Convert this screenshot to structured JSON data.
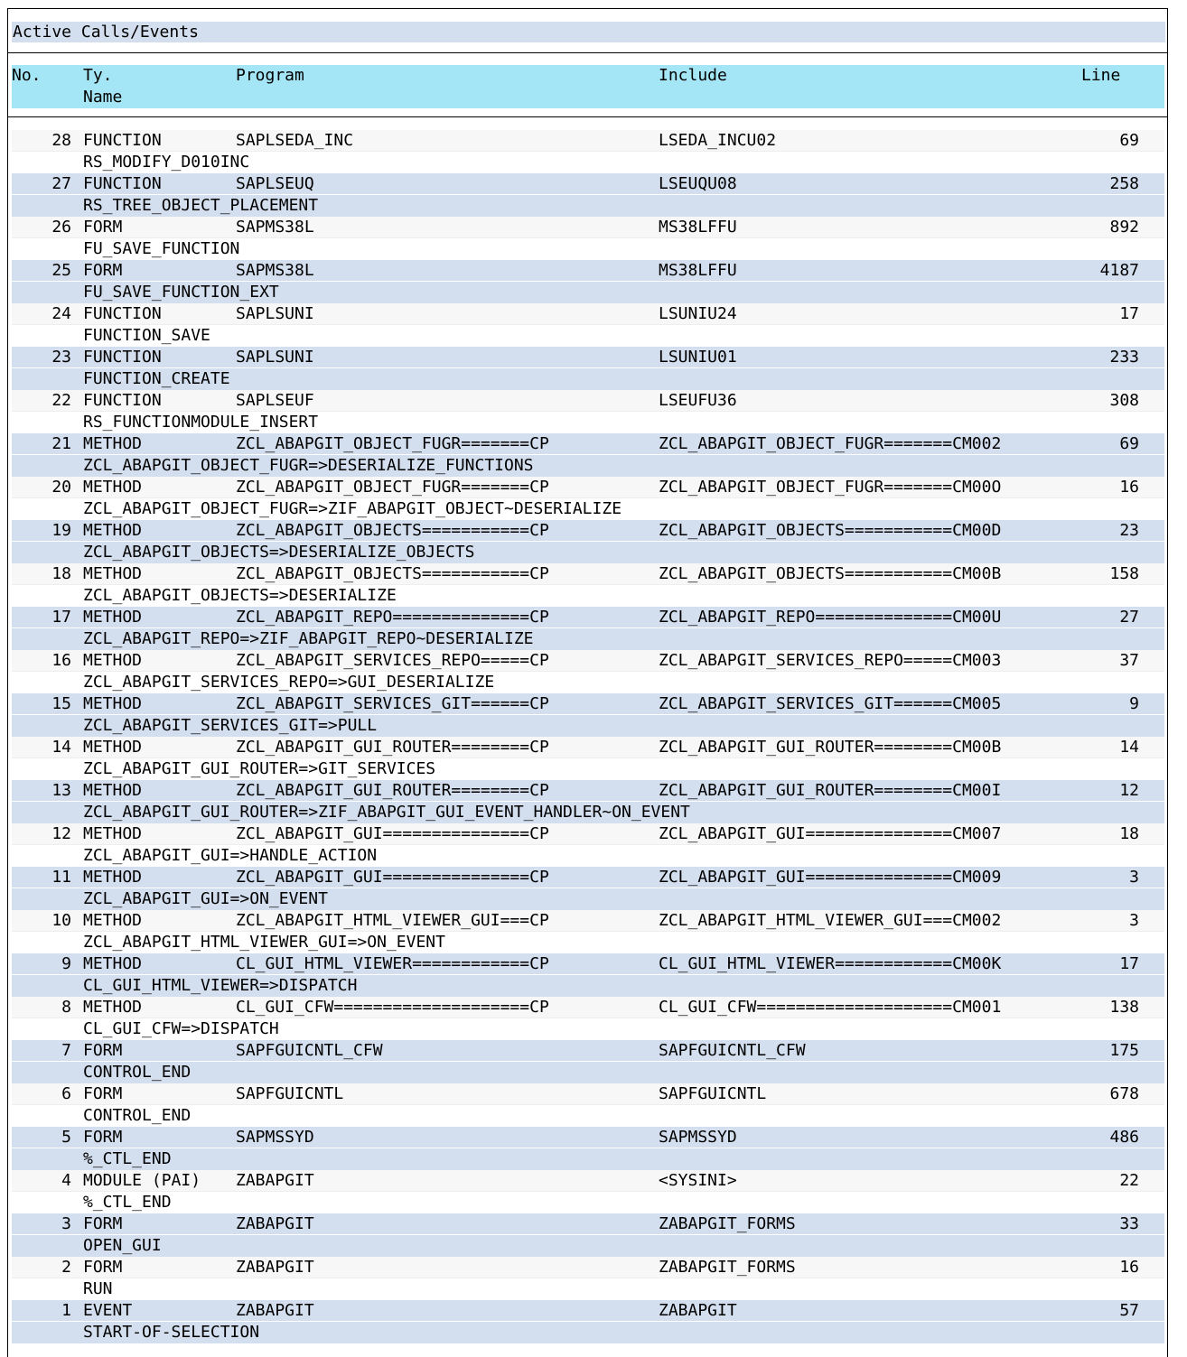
{
  "window": {
    "title": "Active Calls/Events"
  },
  "columns": {
    "no": "No.",
    "type": "Ty.",
    "program": "Program",
    "include": "Include",
    "line": "Line",
    "name": "Name"
  },
  "rows": [
    {
      "no": "28",
      "type": "FUNCTION",
      "program": "SAPLSEDA_INC",
      "include": "LSEDA_INCU02",
      "line": "69",
      "name": "RS_MODIFY_D010INC"
    },
    {
      "no": "27",
      "type": "FUNCTION",
      "program": "SAPLSEUQ",
      "include": "LSEUQU08",
      "line": "258",
      "name": "RS_TREE_OBJECT_PLACEMENT"
    },
    {
      "no": "26",
      "type": "FORM",
      "program": "SAPMS38L",
      "include": "MS38LFFU",
      "line": "892",
      "name": "FU_SAVE_FUNCTION"
    },
    {
      "no": "25",
      "type": "FORM",
      "program": "SAPMS38L",
      "include": "MS38LFFU",
      "line": "4187",
      "name": "FU_SAVE_FUNCTION_EXT"
    },
    {
      "no": "24",
      "type": "FUNCTION",
      "program": "SAPLSUNI",
      "include": "LSUNIU24",
      "line": "17",
      "name": "FUNCTION_SAVE"
    },
    {
      "no": "23",
      "type": "FUNCTION",
      "program": "SAPLSUNI",
      "include": "LSUNIU01",
      "line": "233",
      "name": "FUNCTION_CREATE"
    },
    {
      "no": "22",
      "type": "FUNCTION",
      "program": "SAPLSEUF",
      "include": "LSEUFU36",
      "line": "308",
      "name": "RS_FUNCTIONMODULE_INSERT"
    },
    {
      "no": "21",
      "type": "METHOD",
      "program": "ZCL_ABAPGIT_OBJECT_FUGR=======CP",
      "include": "ZCL_ABAPGIT_OBJECT_FUGR=======CM002",
      "line": "69",
      "name": "ZCL_ABAPGIT_OBJECT_FUGR=>DESERIALIZE_FUNCTIONS"
    },
    {
      "no": "20",
      "type": "METHOD",
      "program": "ZCL_ABAPGIT_OBJECT_FUGR=======CP",
      "include": "ZCL_ABAPGIT_OBJECT_FUGR=======CM00O",
      "line": "16",
      "name": "ZCL_ABAPGIT_OBJECT_FUGR=>ZIF_ABAPGIT_OBJECT~DESERIALIZE"
    },
    {
      "no": "19",
      "type": "METHOD",
      "program": "ZCL_ABAPGIT_OBJECTS===========CP",
      "include": "ZCL_ABAPGIT_OBJECTS===========CM00D",
      "line": "23",
      "name": "ZCL_ABAPGIT_OBJECTS=>DESERIALIZE_OBJECTS"
    },
    {
      "no": "18",
      "type": "METHOD",
      "program": "ZCL_ABAPGIT_OBJECTS===========CP",
      "include": "ZCL_ABAPGIT_OBJECTS===========CM00B",
      "line": "158",
      "name": "ZCL_ABAPGIT_OBJECTS=>DESERIALIZE"
    },
    {
      "no": "17",
      "type": "METHOD",
      "program": "ZCL_ABAPGIT_REPO==============CP",
      "include": "ZCL_ABAPGIT_REPO==============CM00U",
      "line": "27",
      "name": "ZCL_ABAPGIT_REPO=>ZIF_ABAPGIT_REPO~DESERIALIZE"
    },
    {
      "no": "16",
      "type": "METHOD",
      "program": "ZCL_ABAPGIT_SERVICES_REPO=====CP",
      "include": "ZCL_ABAPGIT_SERVICES_REPO=====CM003",
      "line": "37",
      "name": "ZCL_ABAPGIT_SERVICES_REPO=>GUI_DESERIALIZE"
    },
    {
      "no": "15",
      "type": "METHOD",
      "program": "ZCL_ABAPGIT_SERVICES_GIT======CP",
      "include": "ZCL_ABAPGIT_SERVICES_GIT======CM005",
      "line": "9",
      "name": "ZCL_ABAPGIT_SERVICES_GIT=>PULL"
    },
    {
      "no": "14",
      "type": "METHOD",
      "program": "ZCL_ABAPGIT_GUI_ROUTER========CP",
      "include": "ZCL_ABAPGIT_GUI_ROUTER========CM00B",
      "line": "14",
      "name": "ZCL_ABAPGIT_GUI_ROUTER=>GIT_SERVICES"
    },
    {
      "no": "13",
      "type": "METHOD",
      "program": "ZCL_ABAPGIT_GUI_ROUTER========CP",
      "include": "ZCL_ABAPGIT_GUI_ROUTER========CM00I",
      "line": "12",
      "name": "ZCL_ABAPGIT_GUI_ROUTER=>ZIF_ABAPGIT_GUI_EVENT_HANDLER~ON_EVENT"
    },
    {
      "no": "12",
      "type": "METHOD",
      "program": "ZCL_ABAPGIT_GUI===============CP",
      "include": "ZCL_ABAPGIT_GUI===============CM007",
      "line": "18",
      "name": "ZCL_ABAPGIT_GUI=>HANDLE_ACTION"
    },
    {
      "no": "11",
      "type": "METHOD",
      "program": "ZCL_ABAPGIT_GUI===============CP",
      "include": "ZCL_ABAPGIT_GUI===============CM009",
      "line": "3",
      "name": "ZCL_ABAPGIT_GUI=>ON_EVENT"
    },
    {
      "no": "10",
      "type": "METHOD",
      "program": "ZCL_ABAPGIT_HTML_VIEWER_GUI===CP",
      "include": "ZCL_ABAPGIT_HTML_VIEWER_GUI===CM002",
      "line": "3",
      "name": "ZCL_ABAPGIT_HTML_VIEWER_GUI=>ON_EVENT"
    },
    {
      "no": "9",
      "type": "METHOD",
      "program": "CL_GUI_HTML_VIEWER============CP",
      "include": "CL_GUI_HTML_VIEWER============CM00K",
      "line": "17",
      "name": "CL_GUI_HTML_VIEWER=>DISPATCH"
    },
    {
      "no": "8",
      "type": "METHOD",
      "program": "CL_GUI_CFW====================CP",
      "include": "CL_GUI_CFW====================CM001",
      "line": "138",
      "name": "CL_GUI_CFW=>DISPATCH"
    },
    {
      "no": "7",
      "type": "FORM",
      "program": "SAPFGUICNTL_CFW",
      "include": "SAPFGUICNTL_CFW",
      "line": "175",
      "name": "CONTROL_END"
    },
    {
      "no": "6",
      "type": "FORM",
      "program": "SAPFGUICNTL",
      "include": "SAPFGUICNTL",
      "line": "678",
      "name": "CONTROL_END"
    },
    {
      "no": "5",
      "type": "FORM",
      "program": "SAPMSSYD",
      "include": "SAPMSSYD",
      "line": "486",
      "name": "%_CTL_END"
    },
    {
      "no": "4",
      "type": "MODULE (PAI)",
      "program": "ZABAPGIT",
      "include": "<SYSINI>",
      "line": "22",
      "name": "%_CTL_END"
    },
    {
      "no": "3",
      "type": "FORM",
      "program": "ZABAPGIT",
      "include": "ZABAPGIT_FORMS",
      "line": "33",
      "name": "OPEN_GUI"
    },
    {
      "no": "2",
      "type": "FORM",
      "program": "ZABAPGIT",
      "include": "ZABAPGIT_FORMS",
      "line": "16",
      "name": "RUN"
    },
    {
      "no": "1",
      "type": "EVENT",
      "program": "ZABAPGIT",
      "include": "ZABAPGIT",
      "line": "57",
      "name": "START-OF-SELECTION"
    }
  ],
  "colors": {
    "title_bg": "#d3deee",
    "header_bg": "#a4e6f5",
    "alt_row_bg": "#d3deee"
  }
}
